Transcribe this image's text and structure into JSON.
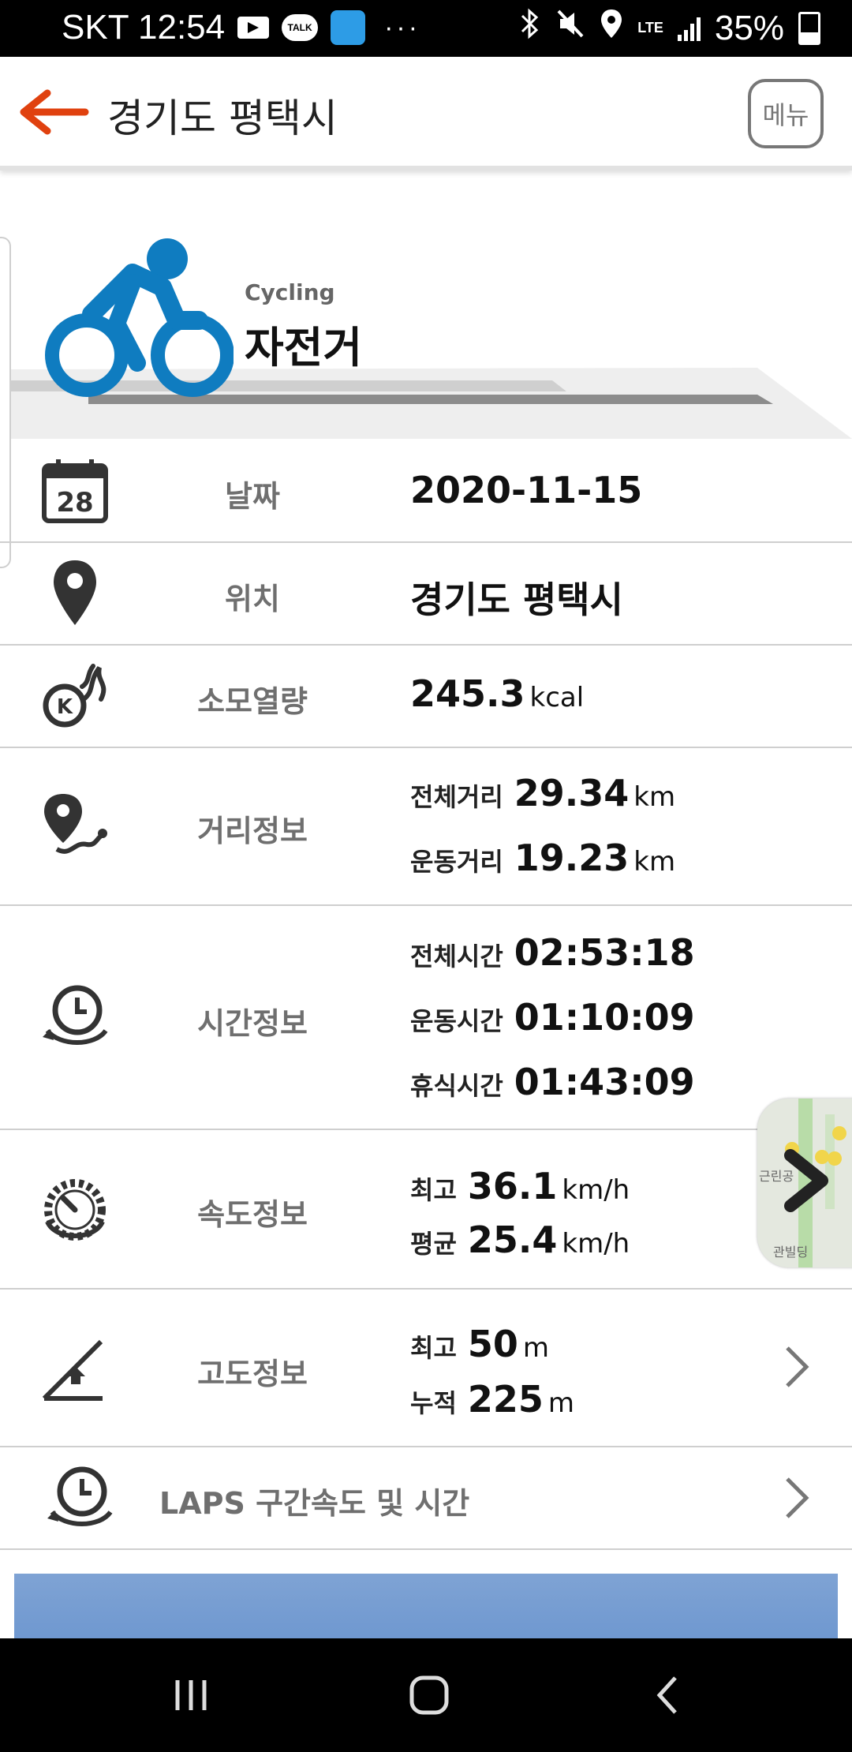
{
  "status_bar": {
    "carrier_time": "SKT 12:54",
    "talk_badge": "TALK",
    "dots": "···",
    "network": "LTE",
    "battery": "35%"
  },
  "header": {
    "title": "경기도 평택시",
    "menu_label": "메뉴"
  },
  "activity": {
    "name_en": "Cycling",
    "name_ko": "자전거",
    "accent_color": "#0f7cc0"
  },
  "rows": {
    "date": {
      "label": "날짜",
      "value": "2020-11-15",
      "calendar_day": "28"
    },
    "location": {
      "label": "위치",
      "value": "경기도 평택시"
    },
    "calories": {
      "label": "소모열량",
      "value": "245.3",
      "unit": "kcal"
    },
    "distance": {
      "label": "거리정보",
      "total_label": "전체거리",
      "total_value": "29.34",
      "total_unit": "km",
      "moving_label": "운동거리",
      "moving_value": "19.23",
      "moving_unit": "km"
    },
    "time": {
      "label": "시간정보",
      "total_label": "전체시간",
      "total_value": "02:53:18",
      "moving_label": "운동시간",
      "moving_value": "01:10:09",
      "rest_label": "휴식시간",
      "rest_value": "01:43:09"
    },
    "speed": {
      "label": "속도정보",
      "max_label": "최고",
      "max_value": "36.1",
      "max_unit": "km/h",
      "avg_label": "평균",
      "avg_value": "25.4",
      "avg_unit": "km/h"
    },
    "altitude": {
      "label": "고도정보",
      "max_label": "최고",
      "max_value": "50",
      "max_unit": "m",
      "cum_label": "누적",
      "cum_value": "225",
      "cum_unit": "m"
    },
    "laps": {
      "label": "LAPS 구간속도 및 시간"
    }
  },
  "map_thumb": {
    "text1": "근린공",
    "text2": "관빌딩"
  }
}
